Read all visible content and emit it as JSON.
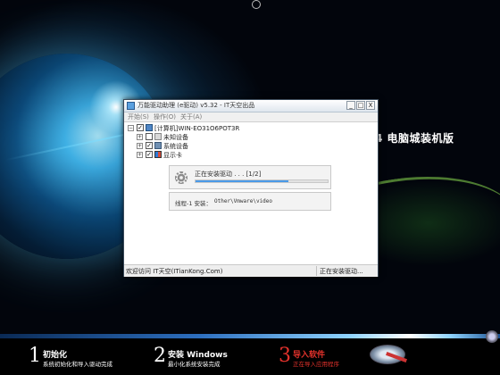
{
  "window": {
    "title": "万能驱动助理 (e驱动) v5.32 - IT天空出品",
    "buttons": {
      "minimize": "_",
      "maximize": "□",
      "close": "X"
    },
    "menu": [
      "开始(S)",
      "操作(O)",
      "关于(A)"
    ],
    "tree": {
      "root": "[计算机]WIN-EO31O6POT3R",
      "children": [
        {
          "label": "未知设备",
          "checked": false
        },
        {
          "label": "系统设备",
          "checked": true
        },
        {
          "label": "显示卡",
          "checked": true
        }
      ]
    },
    "progress": {
      "label": "正在安装驱动 . . . [1/2]",
      "percent": 70,
      "thread_label": "线程-1 安装：",
      "thread_path": "Other\\Vmware\\video"
    },
    "status": {
      "left": "欢迎访问 IT天空(ITianKong.Com)",
      "right": "正在安装驱动..."
    }
  },
  "desktop": {
    "brand_text": "4 电脑城装机版"
  },
  "steps": [
    {
      "num": "1",
      "title": "初始化",
      "desc": "系统初始化和导入驱动完成"
    },
    {
      "num": "2",
      "title": "安装 Windows",
      "desc": "最小化系统安装完成"
    },
    {
      "num": "3",
      "title": "导入软件",
      "desc": "正在导入应用程序"
    }
  ],
  "colors": {
    "active_step": "#e4322c",
    "progress_fill": "#4a9ae8"
  }
}
